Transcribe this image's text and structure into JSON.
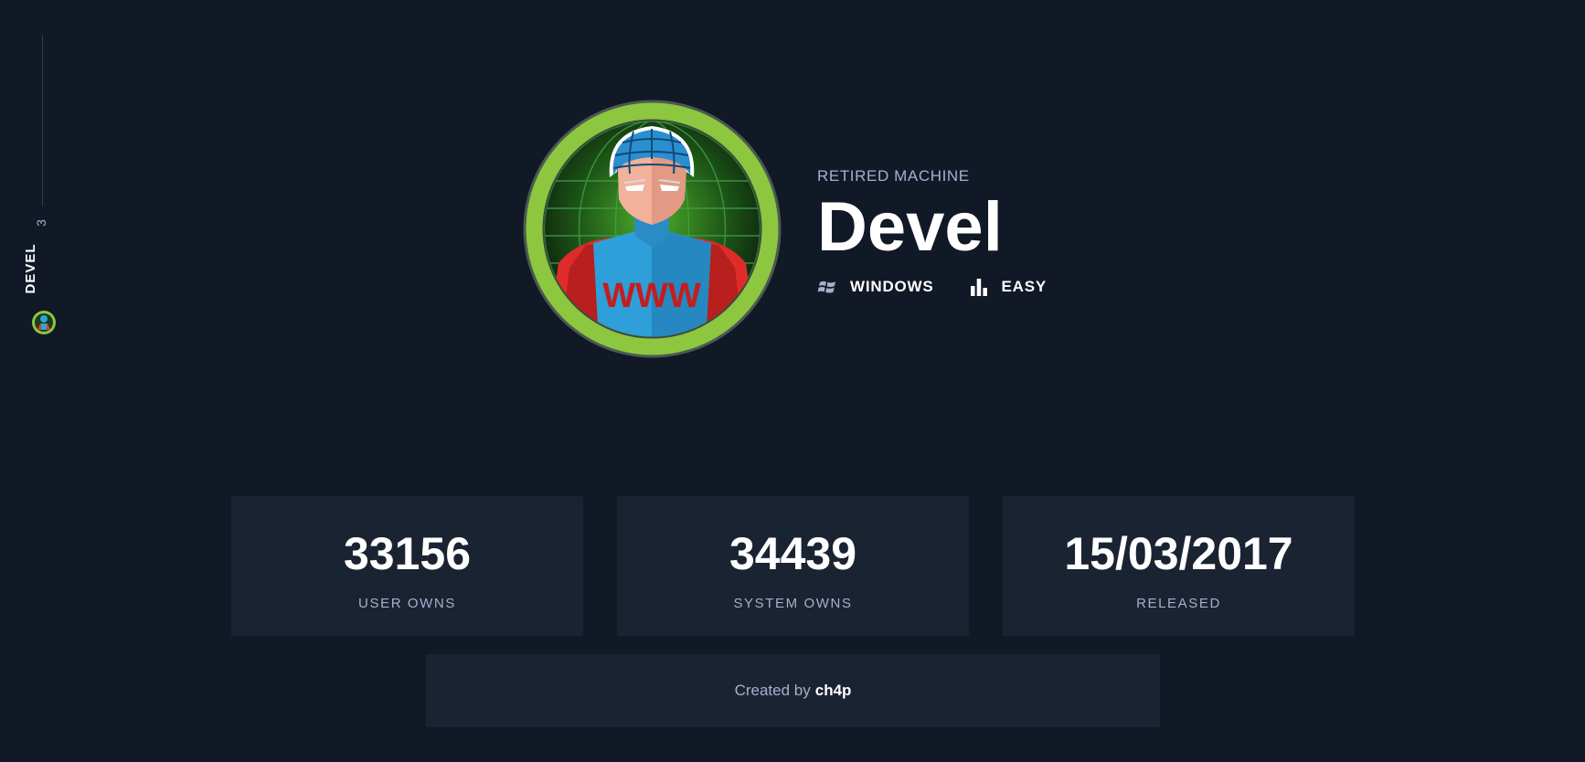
{
  "rail": {
    "number": "3",
    "machine_name": "DEVEL"
  },
  "hero": {
    "status": "RETIRED MACHINE",
    "name": "Devel",
    "os": {
      "label": "WINDOWS",
      "icon": "windows-logo-icon"
    },
    "difficulty": {
      "label": "EASY",
      "icon": "bar-chart-icon"
    },
    "avatar": {
      "ring_color": "#8dc63f",
      "banner_text": "WWW"
    }
  },
  "stats": [
    {
      "value": "33156",
      "label": "USER OWNS"
    },
    {
      "value": "34439",
      "label": "SYSTEM OWNS"
    },
    {
      "value": "15/03/2017",
      "label": "RELEASED"
    }
  ],
  "creator": {
    "prefix": "Created by",
    "name": "ch4p"
  },
  "colors": {
    "background": "#111927",
    "card": "#1a2332",
    "muted_text": "#a4b1cd",
    "accent_green": "#8dc63f"
  }
}
